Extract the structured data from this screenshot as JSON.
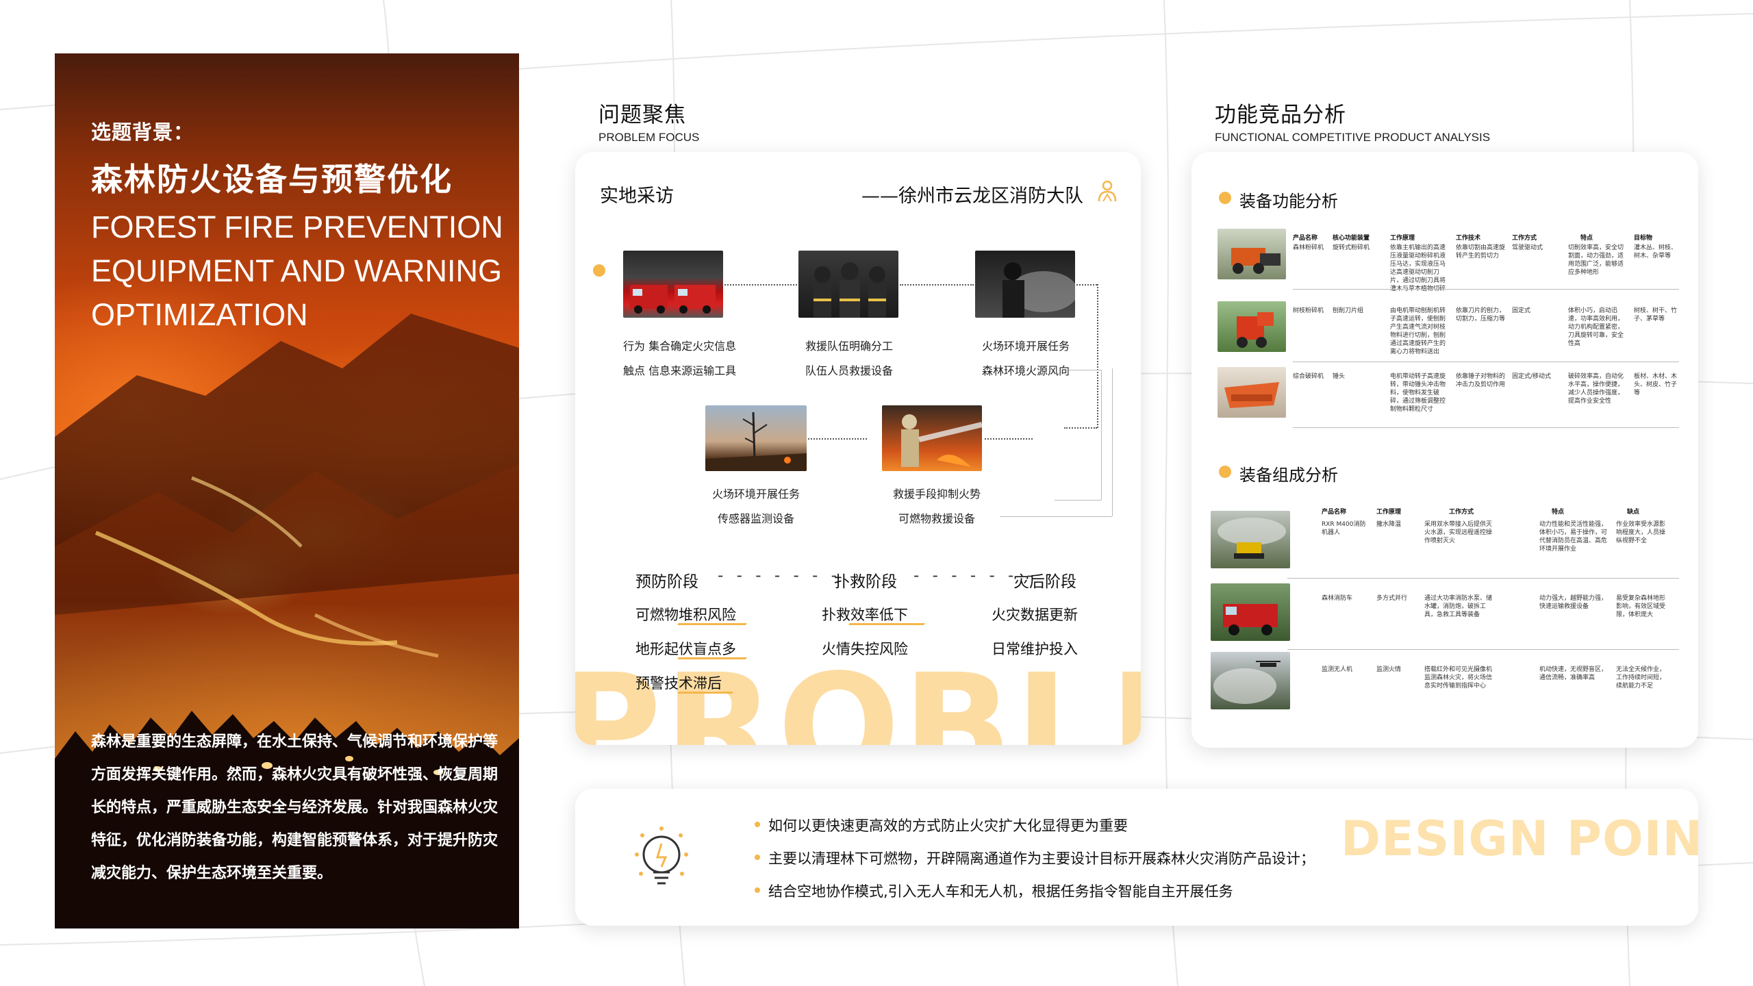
{
  "poster": {
    "subtitle": "选题背景：",
    "title_cn": "森林防火设备与预警优化",
    "title_en": "FOREST FIRE PREVENTION EQUIPMENT AND WARNING OPTIMIZATION",
    "description": "森林是重要的生态屏障，在水土保持、气候调节和环境保护等方面发挥关键作用。然而，森林火灾具有破坏性强、恢复周期长的特点，严重威胁生态安全与经济发展。针对我国森林火灾特征，优化消防装备功能，构建智能预警体系，对于提升防灾减灾能力、保护生态环境至关重要。"
  },
  "problem": {
    "heading_cn": "问题聚焦",
    "heading_en": "PROBLEM FOCUS",
    "field_visit": "实地采访",
    "team": "——徐州市云龙区消防大队",
    "flow": {
      "row1": [
        {
          "line1": "行为  集合确定火灾信息",
          "line2": "触点  信息来源运输工具"
        },
        {
          "line1": "救援队伍明确分工",
          "line2": "队伍人员救援设备"
        },
        {
          "line1": "火场环境开展任务",
          "line2": "森林环境火源风向"
        }
      ],
      "row2": [
        {
          "line1": "火场环境开展任务",
          "line2": "传感器监测设备"
        },
        {
          "line1": "救援手段抑制火势",
          "line2": "可燃物救援设备"
        }
      ]
    },
    "stages": [
      "预防阶段",
      "扑救阶段",
      "灾后阶段"
    ],
    "dash1": "- - - - - - -",
    "dash2": "- - - - - - -",
    "issues": {
      "prevention": [
        "可燃物堆积风险",
        "地形起伏盲点多",
        "预警技术滞后"
      ],
      "rescue": [
        "扑救效率低下",
        "火情失控风险"
      ],
      "post": [
        "火灾数据更新",
        "日常维护投入"
      ]
    },
    "watermark": "PROBLE"
  },
  "functional": {
    "heading_cn": "功能竞品分析",
    "heading_en": "FUNCTIONAL COMPETITIVE PRODUCT ANALYSIS",
    "section1": "装备功能分析",
    "section2": "装备组成分析",
    "table1_headers": [
      "产品名称",
      "核心功能装置",
      "工作原理",
      "工作技术",
      "工作方式",
      "特点",
      "目标物"
    ],
    "table1_rows": [
      [
        "森林粉碎机",
        "旋转式粉碎机",
        "依靠主机输出的高速压液量驱动粉碎机液压马达，实现液压马达高速驱动切削刀片，通过切削刀具将灌木与草本植物切碎",
        "依靠切割由高速旋转产生的剪切力",
        "驾驶驱动式",
        "切削效率高，安全切割面，动力强劲，适用范围广泛，能够适应多种地形",
        "灌木丛、树枝、树木、杂草等"
      ],
      [
        "树枝粉碎机",
        "刨削刀片组",
        "由电机带动刨削机转子高速运转，使刨削产生高速气流对树枝物料进行切削，刨削通过高速旋转产生的离心力将物料送出",
        "依靠刀片的刨力，切割力，压缩力等",
        "固定式",
        "体积小巧，启动迅速，功率高效利用，动力机构配置紧密，刀具旋转可靠，安全性高",
        "树枝、树干、竹子、茅草等"
      ],
      [
        "综合破碎机",
        "锤头",
        "电机带动转子高速旋转，带动锤头冲击物料，使物料发生破碎，通过筛板调整控制物料颗粒尺寸",
        "依靠锤子对物料的冲击力及剪切作用",
        "固定式/移动式",
        "破碎效率高，自动化水平高，操作便捷，减少人员操作强度，提高作业安全性",
        "板材、木材、木头、树皮、竹子等"
      ]
    ],
    "table2_headers": [
      "产品名称",
      "工作原理",
      "工作方式",
      "特点",
      "缺点"
    ],
    "table2_rows": [
      [
        "RXR M400消防机器人",
        "撒水降温",
        "采用双水带接入后提供灭火水源，实现远程遥控操作喷射灭火",
        "动力性能和灵活性能强，体积小巧，易于操作，可代替消防员在高温、高危环境开展作业",
        "作业效率受水源影响程度大，人员操纵视野不全"
      ],
      [
        "森林消防车",
        "多方式并行",
        "通过大功率消防水泵、储水罐，消防炮，破拆工具，急救工具等装备",
        "动力强大，越野能力强，快速运输救援设备",
        "易受复杂森林地形影响，有效区域受限，体积庞大"
      ],
      [
        "监测无人机",
        "监测火情",
        "搭载红外和可见光摄像机监测森林火灾，将火场信息实时传输到指挥中心",
        "机动快速，无视野盲区，通信流畅，准确率高",
        "无法全天候作业，工作持续时间短，续航能力不足"
      ]
    ]
  },
  "design": {
    "bullets": [
      "如何以更快速更高效的方式防止火灾扩大化显得更为重要",
      "主要以清理林下可燃物，开辟隔离通道作为主要设计目标开展森林火灾消防产品设计；",
      "结合空地协作模式,引入无人车和无人机，根据任务指令智能自主开展任务"
    ],
    "watermark": "DESIGN POINTS"
  },
  "colors": {
    "accent": "#f5b64a",
    "watermark": "#fddca2",
    "poster_orange": "#e0600e"
  }
}
